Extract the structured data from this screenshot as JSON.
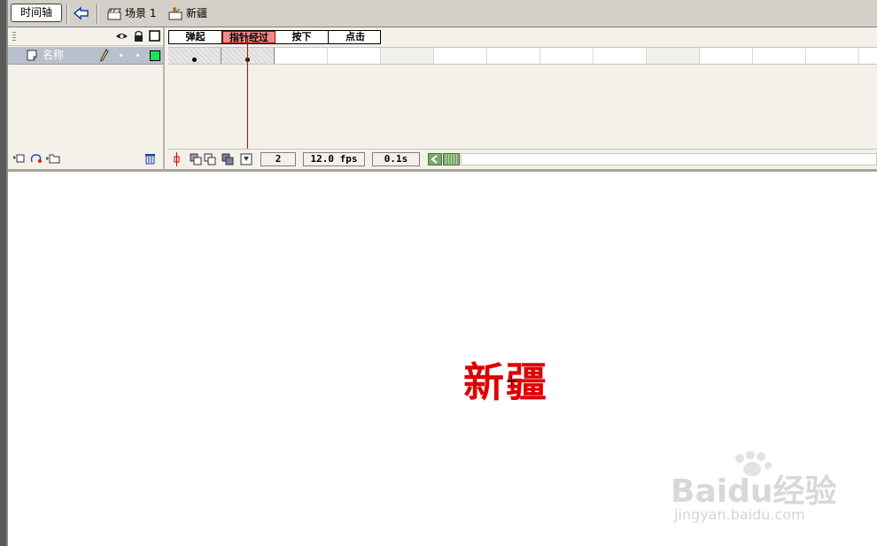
{
  "toolbar": {
    "timeline_label": "时间轴",
    "breadcrumbs": [
      {
        "label": "场景 1",
        "icon": "scene-icon"
      },
      {
        "label": "新疆",
        "icon": "button-symbol-icon"
      }
    ]
  },
  "layers": {
    "items": [
      {
        "name": "名称",
        "icon": "layer-page-icon"
      }
    ],
    "header_icons": [
      "eye-icon",
      "lock-icon",
      "outline-icon"
    ]
  },
  "frames": {
    "labels": [
      "弹起",
      "指针经过",
      "按下",
      "点击"
    ],
    "active_label_index": 1,
    "current_frame": "2",
    "fps": "12.0 fps",
    "elapsed": "0.1s"
  },
  "stage": {
    "text": "新疆",
    "text_color": "#e00000"
  },
  "watermark": {
    "brand": "Baidu经验",
    "url": "jingyan.baidu.com"
  },
  "colors": {
    "panel_bg": "#d4d0c8",
    "timeline_bg": "#f3f1ea",
    "layer_selected": "#b9bfcc",
    "playhead": "#cc0000",
    "active_frame_label": "#f08a8a"
  }
}
